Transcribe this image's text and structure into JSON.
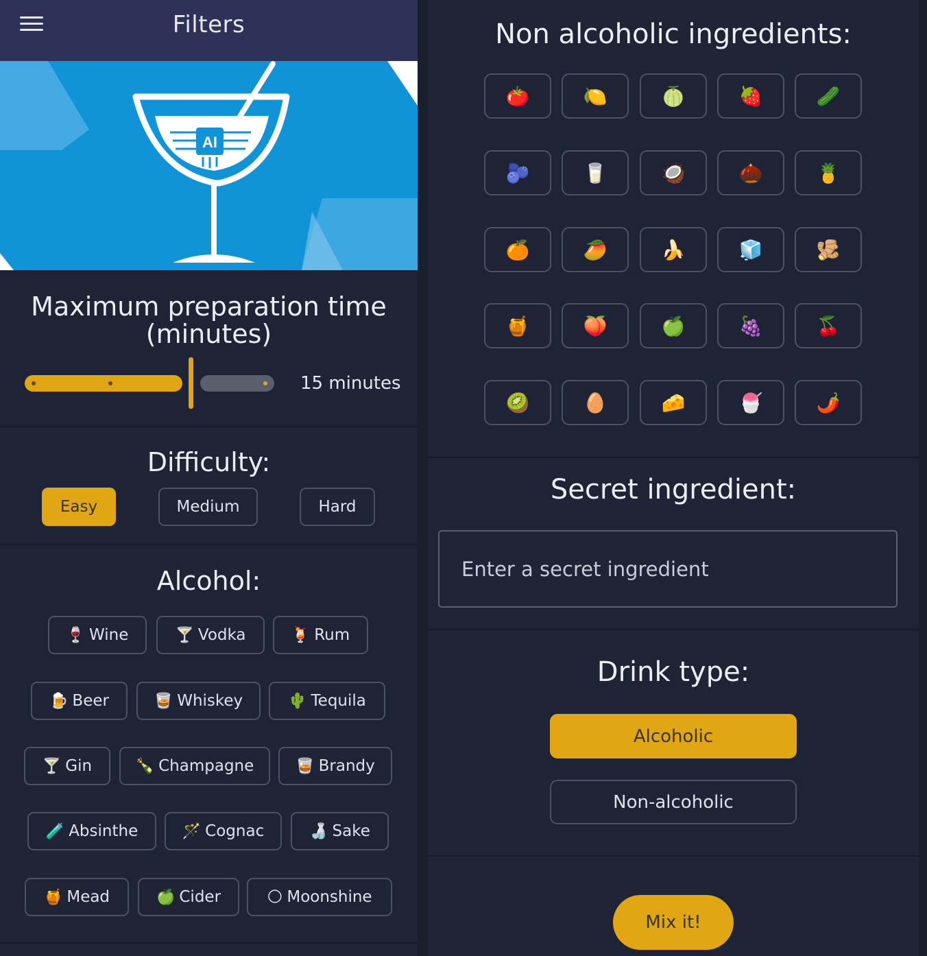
{
  "app_bar": {
    "title": "Filters"
  },
  "banner": {
    "chip_text": "AI"
  },
  "prep_time": {
    "title_line1": "Maximum preparation time",
    "title_line2": "(minutes)",
    "value_label": "15 minutes",
    "slider_level": 0.67
  },
  "difficulty": {
    "title": "Difficulty:",
    "options": [
      "Easy",
      "Medium",
      "Hard"
    ],
    "selected": "Easy"
  },
  "alcohol": {
    "title": "Alcohol:",
    "rows": [
      [
        {
          "icon": "🍷",
          "label": "Wine"
        },
        {
          "icon": "🍸",
          "label": "Vodka"
        },
        {
          "icon": "🍹",
          "label": "Rum"
        }
      ],
      [
        {
          "icon": "🍺",
          "label": "Beer"
        },
        {
          "icon": "🥃",
          "label": "Whiskey"
        },
        {
          "icon": "🌵",
          "label": "Tequila"
        }
      ],
      [
        {
          "icon": "🍸",
          "label": "Gin"
        },
        {
          "icon": "🍾",
          "label": "Champagne"
        },
        {
          "icon": "🥃",
          "label": "Brandy"
        }
      ],
      [
        {
          "icon": "🧪",
          "label": "Absinthe"
        },
        {
          "icon": "🪄",
          "label": "Cognac"
        },
        {
          "icon": "🍶",
          "label": "Sake"
        }
      ],
      [
        {
          "icon": "🍯",
          "label": "Mead"
        },
        {
          "icon": "🍏",
          "label": "Cider"
        },
        {
          "icon": "🌕",
          "label": "Moonshine"
        }
      ]
    ]
  },
  "non_alcoholic": {
    "title": "Non alcoholic ingredients:",
    "items": [
      "🍅",
      "🍋",
      "🍈",
      "🍓",
      "🥒",
      "🫐",
      "🥛",
      "🥥",
      "🌰",
      "🍍",
      "🍊",
      "🥭",
      "🍌",
      "🧊",
      "🫚",
      "🍯",
      "🍑",
      "🍏",
      "🍇",
      "🍒",
      "🥝",
      "🥚",
      "🧀",
      "🍧",
      "🌶️"
    ]
  },
  "secret": {
    "title": "Secret ingredient:",
    "placeholder": "Enter a secret ingredient",
    "value": ""
  },
  "drink_type": {
    "title": "Drink type:",
    "options": [
      "Alcoholic",
      "Non-alcoholic"
    ],
    "selected": "Alcoholic"
  },
  "mix_button": "Mix it!",
  "colors": {
    "accent": "#e0a614",
    "background": "#1e2435",
    "app_bar": "#2e3158",
    "banner": "#1193d8"
  }
}
